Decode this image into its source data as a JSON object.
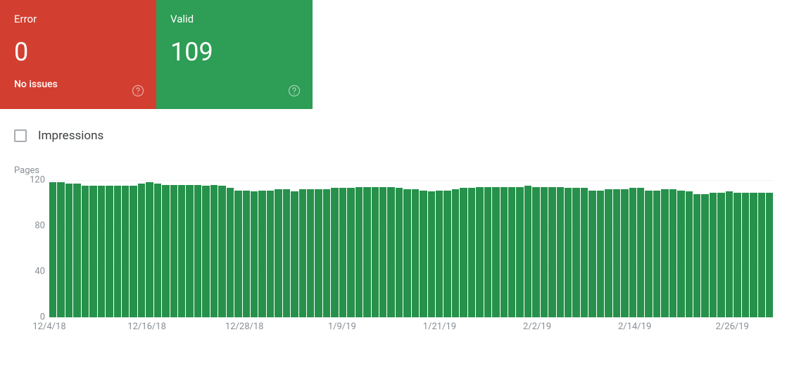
{
  "cards": {
    "error": {
      "title": "Error",
      "value": "0",
      "sub": "No issues"
    },
    "valid": {
      "title": "Valid",
      "value": "109",
      "sub": ""
    }
  },
  "impressions_label": "Impressions",
  "chart_data": {
    "type": "bar",
    "title": "",
    "ylabel": "Pages",
    "ylim": [
      0,
      120
    ],
    "y_ticks": [
      0,
      40,
      80,
      120
    ],
    "x_ticks": [
      "12/4/18",
      "12/16/18",
      "12/28/18",
      "1/9/19",
      "1/21/19",
      "2/2/19",
      "2/14/19",
      "2/26/19"
    ],
    "categories": [
      "12/4/18",
      "12/5/18",
      "12/6/18",
      "12/7/18",
      "12/8/18",
      "12/9/18",
      "12/10/18",
      "12/11/18",
      "12/12/18",
      "12/13/18",
      "12/14/18",
      "12/15/18",
      "12/16/18",
      "12/17/18",
      "12/18/18",
      "12/19/18",
      "12/20/18",
      "12/21/18",
      "12/22/18",
      "12/23/18",
      "12/24/18",
      "12/25/18",
      "12/26/18",
      "12/27/18",
      "12/28/18",
      "12/29/18",
      "12/30/18",
      "12/31/18",
      "1/1/19",
      "1/2/19",
      "1/3/19",
      "1/4/19",
      "1/5/19",
      "1/6/19",
      "1/7/19",
      "1/8/19",
      "1/9/19",
      "1/10/19",
      "1/11/19",
      "1/12/19",
      "1/13/19",
      "1/14/19",
      "1/15/19",
      "1/16/19",
      "1/17/19",
      "1/18/19",
      "1/19/19",
      "1/20/19",
      "1/21/19",
      "1/22/19",
      "1/23/19",
      "1/24/19",
      "1/25/19",
      "1/26/19",
      "1/27/19",
      "1/28/19",
      "1/29/19",
      "1/30/19",
      "1/31/19",
      "2/1/19",
      "2/2/19",
      "2/3/19",
      "2/4/19",
      "2/5/19",
      "2/6/19",
      "2/7/19",
      "2/8/19",
      "2/9/19",
      "2/10/19",
      "2/11/19",
      "2/12/19",
      "2/13/19",
      "2/14/19",
      "2/15/19",
      "2/16/19",
      "2/17/19",
      "2/18/19",
      "2/19/19",
      "2/20/19",
      "2/21/19",
      "2/22/19",
      "2/23/19",
      "2/24/19",
      "2/25/19",
      "2/26/19",
      "2/27/19",
      "2/28/19",
      "3/1/19",
      "3/2/19",
      "3/3/19"
    ],
    "values": [
      118,
      118,
      117,
      117,
      115,
      115,
      115,
      115,
      115,
      115,
      115,
      117,
      118,
      117,
      116,
      116,
      116,
      116,
      116,
      115,
      116,
      115,
      113,
      111,
      111,
      110,
      111,
      111,
      112,
      112,
      110,
      112,
      112,
      112,
      112,
      113,
      113,
      113,
      114,
      114,
      114,
      114,
      114,
      113,
      112,
      112,
      111,
      110,
      111,
      111,
      112,
      113,
      113,
      114,
      114,
      114,
      114,
      114,
      114,
      115,
      114,
      114,
      114,
      114,
      113,
      113,
      113,
      111,
      111,
      112,
      112,
      112,
      113,
      113,
      111,
      111,
      112,
      112,
      111,
      110,
      108,
      108,
      109,
      109,
      110,
      109,
      109,
      109,
      109,
      109
    ]
  }
}
